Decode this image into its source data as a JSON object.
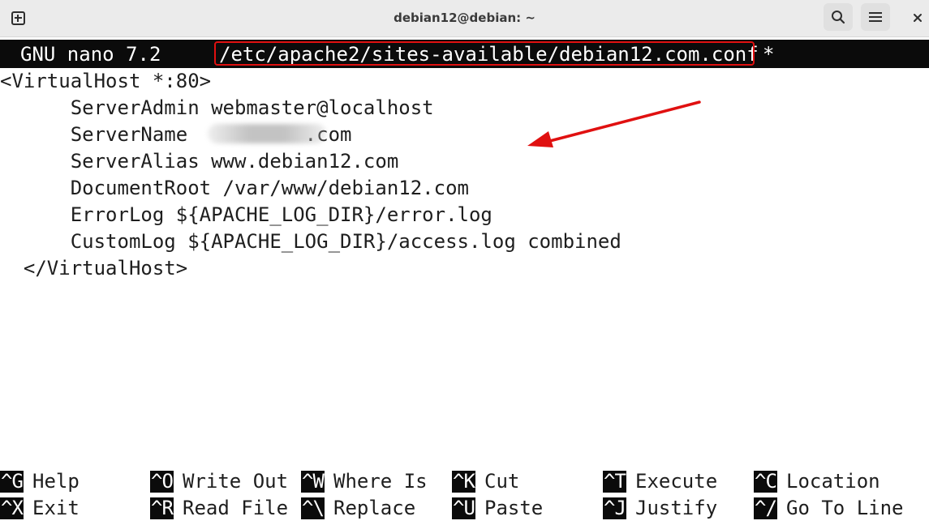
{
  "window": {
    "title": "debian12@debian: ~",
    "icons": {
      "new_tab": "new-tab-icon",
      "search": "search-icon",
      "menu": "hamburger-menu-icon",
      "close": "close-icon"
    }
  },
  "nano": {
    "version": "GNU nano 7.2",
    "filename": "/etc/apache2/sites-available/debian12.com.conf",
    "modified_marker": "*"
  },
  "file_lines": [
    "<VirtualHost *:80>",
    "      ServerAdmin webmaster@localhost",
    "      ServerName          .com",
    "      ServerAlias www.debian12.com",
    "      DocumentRoot /var/www/debian12.com",
    "      ErrorLog ${APACHE_LOG_DIR}/error.log",
    "      CustomLog ${APACHE_LOG_DIR}/access.log combined",
    "  </VirtualHost>"
  ],
  "shortcuts_row1": [
    {
      "key": "^G",
      "label": "Help"
    },
    {
      "key": "^O",
      "label": "Write Out"
    },
    {
      "key": "^W",
      "label": "Where Is"
    },
    {
      "key": "^K",
      "label": "Cut"
    },
    {
      "key": "^T",
      "label": "Execute"
    },
    {
      "key": "^C",
      "label": "Location"
    }
  ],
  "shortcuts_row2": [
    {
      "key": "^X",
      "label": "Exit"
    },
    {
      "key": "^R",
      "label": "Read File"
    },
    {
      "key": "^\\",
      "label": "Replace"
    },
    {
      "key": "^U",
      "label": "Paste"
    },
    {
      "key": "^J",
      "label": "Justify"
    },
    {
      "key": "^/",
      "label": "Go To Line"
    }
  ],
  "colors": {
    "annotation": "#e01010",
    "header_bg": "#0b0b0b",
    "titlebar_bg": "#ebebeb"
  }
}
